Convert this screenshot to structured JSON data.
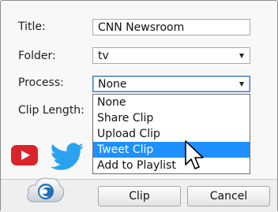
{
  "form": {
    "title_label": "Title:",
    "title_value": "CNN Newsroom",
    "folder_label": "Folder:",
    "folder_value": "tv",
    "process_label": "Process:",
    "process_value": "None",
    "clip_length_label": "Clip Length:"
  },
  "process_dropdown": {
    "options": [
      "None",
      "Share Clip",
      "Upload Clip",
      "Tweet Clip",
      "Add to Playlist"
    ],
    "highlighted": "Tweet Clip"
  },
  "buttons": {
    "clip_label": "Clip",
    "cancel_label": "Cancel"
  },
  "icons": {
    "youtube": "youtube-icon",
    "twitter": "twitter-icon",
    "logo": "cloud-logo-icon",
    "cursor": "mouse-pointer-icon"
  },
  "colors": {
    "highlight": "#1e90ff",
    "youtube_red": "#d9252a",
    "twitter_blue": "#2aa3ef",
    "focus_border": "#3b78c5"
  }
}
